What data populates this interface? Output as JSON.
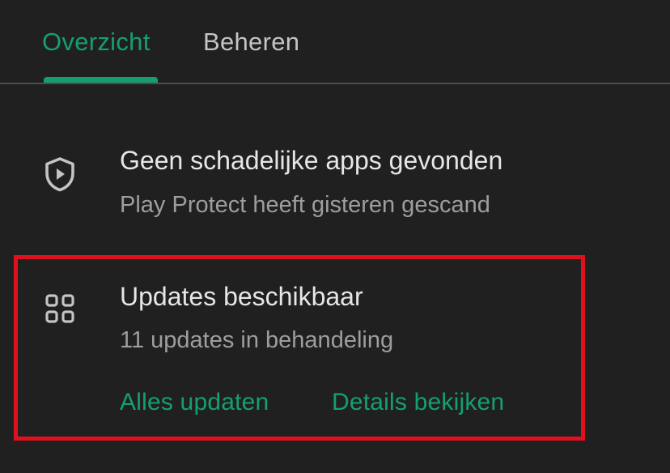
{
  "tabs": [
    {
      "label": "Overzicht",
      "active": true
    },
    {
      "label": "Beheren",
      "active": false
    }
  ],
  "protect": {
    "title": "Geen schadelijke apps gevonden",
    "subtitle": "Play Protect heeft gisteren gescand",
    "icon": "shield-play-icon"
  },
  "updates": {
    "title": "Updates beschikbaar",
    "subtitle": "11 updates in behandeling",
    "icon": "apps-grid-icon",
    "actions": {
      "update_all": "Alles updaten",
      "view_details": "Details bekijken"
    }
  },
  "colors": {
    "background": "#202020",
    "accent": "#14a06e",
    "highlight": "#e0101e",
    "text_primary": "#e6e6e6",
    "text_secondary": "#9e9e9e"
  }
}
